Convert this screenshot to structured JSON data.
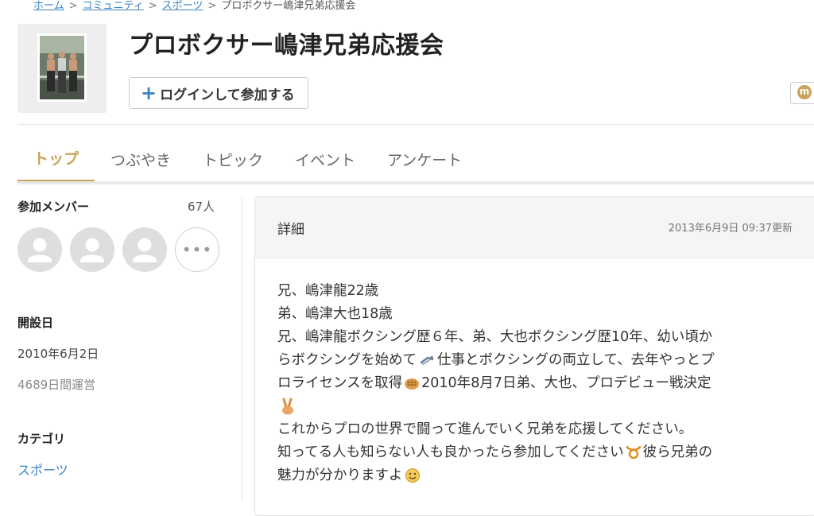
{
  "breadcrumb": {
    "items": [
      {
        "label": "ホーム"
      },
      {
        "label": "コミュニティ"
      },
      {
        "label": "スポーツ"
      }
    ],
    "current": "プロボクサー嶋津兄弟応援会",
    "separator": ">"
  },
  "community": {
    "title": "プロボクサー嶋津兄弟応援会",
    "join_label": "ログインして参加する"
  },
  "header_icons": {
    "m_label": "m"
  },
  "tabs": [
    {
      "label": "トップ",
      "active": true
    },
    {
      "label": "つぶやき"
    },
    {
      "label": "トピック"
    },
    {
      "label": "イベント"
    },
    {
      "label": "アンケート"
    }
  ],
  "sidebar": {
    "members_heading": "参加メンバー",
    "members_count": "67人",
    "more_label": "•••",
    "founded_heading": "開設日",
    "founded_date": "2010年6月2日",
    "running_days": "4689日間運営",
    "category_heading": "カテゴリ",
    "category_value": "スポーツ"
  },
  "detail": {
    "title": "詳細",
    "updated": "2013年6月9日 09:37更新",
    "lines": [
      "兄、嶋津龍22歳",
      "弟、嶋津大也18歳",
      "兄、嶋津龍ボクシング歴６年、弟、大也ボクシング歴10年、幼い頃か",
      "らボクシングを始めて",
      "仕事とボクシングの両立して、去年やっとプ",
      "ロライセンスを取得",
      "2010年8月7日弟、大也、プロデビュー戦決定",
      "これからプロの世界で闘って進んでいく兄弟を応援してください。",
      "知ってる人も知らない人も良かったら参加してください",
      "彼ら兄弟の",
      "魅力が分かりますよ"
    ]
  },
  "colors": {
    "accent": "#c9a35a",
    "link": "#3a82c4",
    "avatar": "#dedede"
  },
  "icons": [
    "plus-icon",
    "m-icon",
    "user-avatar-icon",
    "more-icon",
    "run-emoji-icon",
    "fist-emoji-icon",
    "peace-emoji-icon",
    "taurus-emoji-icon",
    "smile-emoji-icon"
  ]
}
